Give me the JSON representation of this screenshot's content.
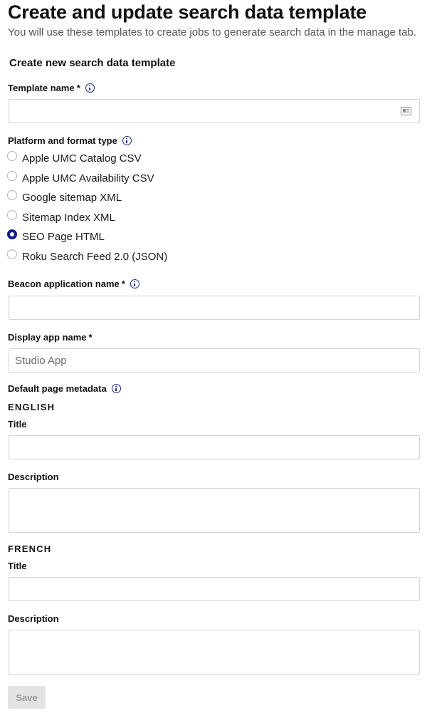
{
  "page": {
    "title": "Create and update search data template",
    "subtitle": "You will use these templates to create jobs to generate search data in the manage tab."
  },
  "form": {
    "section_title": "Create new search data template",
    "template_name": {
      "label": "Template name",
      "required_mark": "*",
      "value": "",
      "trailing_icon": "contact-card-icon"
    },
    "platform": {
      "label": "Platform and format type",
      "options": [
        {
          "label": "Apple UMC Catalog CSV",
          "checked": false
        },
        {
          "label": "Apple UMC Availability CSV",
          "checked": false
        },
        {
          "label": "Google sitemap XML",
          "checked": false
        },
        {
          "label": "Sitemap Index XML",
          "checked": false
        },
        {
          "label": "SEO Page HTML",
          "checked": true
        },
        {
          "label": "Roku Search Feed 2.0 (JSON)",
          "checked": false
        }
      ]
    },
    "beacon_app_name": {
      "label": "Beacon application name",
      "required_mark": "*",
      "value": ""
    },
    "display_app_name": {
      "label": "Display app name",
      "required_mark": "*",
      "placeholder": "Studio App",
      "value": ""
    },
    "default_metadata": {
      "label": "Default page metadata",
      "languages": [
        {
          "heading": "ENGLISH",
          "title_label": "Title",
          "title_value": "",
          "description_label": "Description",
          "description_value": ""
        },
        {
          "heading": "FRENCH",
          "title_label": "Title",
          "title_value": "",
          "description_label": "Description",
          "description_value": ""
        }
      ]
    },
    "save_label": "Save",
    "save_disabled": true
  },
  "colors": {
    "accent": "#141a8c",
    "info_icon": "#1b2a8c",
    "input_border": "#d4d4d4",
    "disabled_button_bg": "#e3e3e3",
    "disabled_button_text": "#9a9a9a"
  }
}
